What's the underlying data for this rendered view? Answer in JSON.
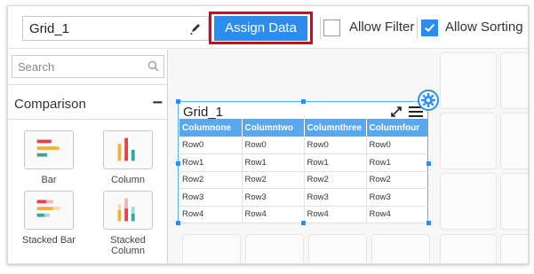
{
  "toolbar": {
    "widget_name": "Grid_1",
    "assign_data_label": "Assign Data",
    "allow_filter": {
      "label": "Allow Filter",
      "checked": false
    },
    "allow_sorting": {
      "label": "Allow Sorting",
      "checked": true
    },
    "accent_color": "#2c8df0",
    "highlight_color": "#e3001b"
  },
  "sidebar": {
    "search_placeholder": "Search",
    "category": {
      "title": "Comparison",
      "toggle": "−"
    },
    "widgets": [
      {
        "label": "Bar",
        "icon": "bar-chart-icon"
      },
      {
        "label": "Column",
        "icon": "column-chart-icon"
      },
      {
        "label": "Stacked Bar",
        "icon": "stacked-bar-chart-icon"
      },
      {
        "label": "Stacked Column",
        "icon": "stacked-column-chart-icon"
      }
    ]
  },
  "grid_widget": {
    "title": "Grid_1",
    "columns": [
      "Columnone",
      "Columntwo",
      "Columnthree",
      "Columnfour"
    ],
    "rows": [
      [
        "Row0",
        "Row0",
        "Row0",
        "Row0"
      ],
      [
        "Row1",
        "Row1",
        "Row1",
        "Row1"
      ],
      [
        "Row2",
        "Row2",
        "Row2",
        "Row2"
      ],
      [
        "Row3",
        "Row3",
        "Row3",
        "Row3"
      ],
      [
        "Row4",
        "Row4",
        "Row4",
        "Row4"
      ]
    ],
    "header_color": "#5aa7ee"
  }
}
